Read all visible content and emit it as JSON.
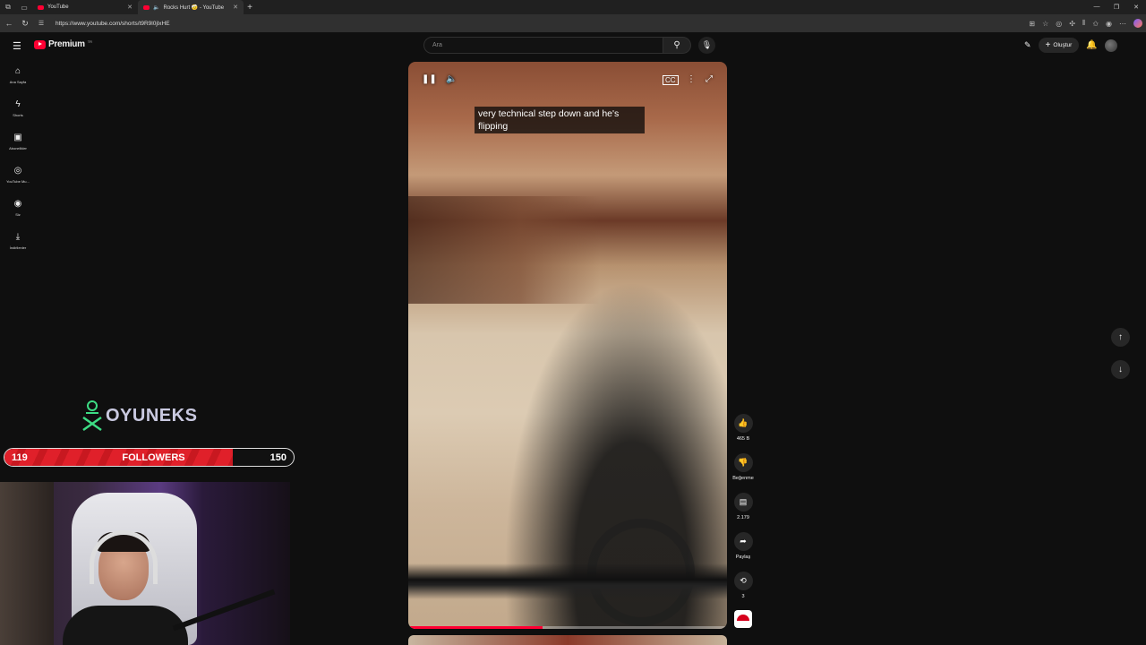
{
  "browser": {
    "tabs": [
      {
        "label": "YouTube"
      },
      {
        "label": "Rocks Hurt 🤕 - YouTube"
      }
    ],
    "url": "https://www.youtube.com/shorts/t9R9l0jlxHE"
  },
  "header": {
    "logo_text": "Premium",
    "logo_region": "TR",
    "search_placeholder": "Ara",
    "create_label": "Oluştur"
  },
  "sidebar": {
    "items": [
      {
        "label": "Ana Sayfa",
        "icon": "home-icon"
      },
      {
        "label": "Shorts",
        "icon": "shorts-icon"
      },
      {
        "label": "Abonelikler",
        "icon": "subscriptions-icon"
      },
      {
        "label": "YouTube Mu...",
        "icon": "youtube-music-icon"
      },
      {
        "label": "Siz",
        "icon": "you-icon"
      },
      {
        "label": "İndirilenler",
        "icon": "downloads-icon"
      }
    ]
  },
  "video": {
    "caption": "very technical step down and he's flipping",
    "progress": 0.42
  },
  "actions": {
    "likes": "465 B",
    "dislike_label": "Beğenme",
    "comments": "2.179",
    "share_label": "Paylaş",
    "remix_count": "3"
  },
  "overlay": {
    "brand": "OYUNEKS",
    "followers_current": "119",
    "followers_label": "FOLLOWERS",
    "followers_goal": "150",
    "followers_progress": 0.79
  },
  "colors": {
    "accent": "#ff0033",
    "background": "#0f0f0f",
    "followers_bar": "#e0202a"
  }
}
